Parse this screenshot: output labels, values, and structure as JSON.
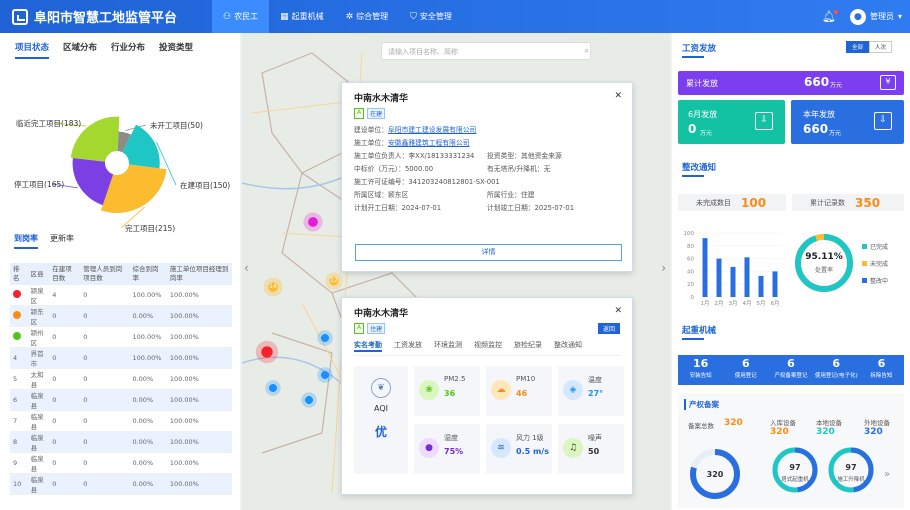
{
  "header": {
    "title": "阜阳市智慧工地监管平台",
    "nav": [
      {
        "icon": "⚇",
        "label": "农民工"
      },
      {
        "icon": "▦",
        "label": "起重机械"
      },
      {
        "icon": "✲",
        "label": "综合管理"
      },
      {
        "icon": "⛉",
        "label": "安全管理"
      }
    ],
    "user": "管理员"
  },
  "left": {
    "tabs": [
      "项目状态",
      "区域分布",
      "行业分布",
      "投资类型"
    ],
    "chart_data": {
      "type": "pie",
      "labels": [
        "未开工项目(50)",
        "在建项目(150)",
        "完工项目(215)",
        "停工项目(165)",
        "临近完工项目(183)"
      ],
      "values": [
        50,
        150,
        215,
        165,
        183
      ],
      "colors": [
        "#8c8c8c",
        "#1fc6c6",
        "#fbbc2f",
        "#7b3fe4",
        "#a4d82e"
      ]
    },
    "tabs2": [
      "到岗率",
      "更新率"
    ],
    "table": {
      "headers": [
        "排名",
        "区县",
        "在建项目数",
        "管理人员到岗项目数",
        "综合到岗率",
        "施工单位项目经理到岗率"
      ],
      "rows": [
        [
          "1",
          "颍泉区",
          "4",
          "0",
          "100.00%",
          "100.00%"
        ],
        [
          "2",
          "颍东区",
          "0",
          "0",
          "0.00%",
          "100.00%"
        ],
        [
          "3",
          "颍州区",
          "0",
          "0",
          "100.00%",
          "100.00%"
        ],
        [
          "4",
          "界首市",
          "0",
          "0",
          "100.00%",
          "100.00%"
        ],
        [
          "5",
          "太和县",
          "0",
          "0",
          "0.00%",
          "100.00%"
        ],
        [
          "6",
          "临泉县",
          "0",
          "0",
          "0.00%",
          "100.00%"
        ],
        [
          "7",
          "临泉县",
          "0",
          "0",
          "0.00%",
          "100.00%"
        ],
        [
          "8",
          "临泉县",
          "0",
          "0",
          "0.00%",
          "100.00%"
        ],
        [
          "9",
          "临泉县",
          "0",
          "0",
          "0.00%",
          "100.00%"
        ],
        [
          "10",
          "临泉县",
          "0",
          "0",
          "0.00%",
          "100.00%"
        ]
      ]
    }
  },
  "map": {
    "search_placeholder": "请输入项目名称、简称",
    "markers": [
      "14",
      "12"
    ],
    "card1": {
      "title": "中南水木清华",
      "tags": [
        "A",
        "在建"
      ],
      "rows": [
        [
          {
            "k": "建设单位：",
            "v": "阜阳市建工建设发展有限公司",
            "link": true
          }
        ],
        [
          {
            "k": "施工单位：",
            "v": "安徽鑫雅建筑工程有限公司",
            "link": true
          }
        ],
        [
          {
            "k": "施工单位负责人：",
            "v": "李XX/18133331234"
          },
          {
            "k": "投资类型：",
            "v": "其他资金来源"
          }
        ],
        [
          {
            "k": "中标价（万元）：",
            "v": "5000.00"
          },
          {
            "k": "有无塔吊/升降机：",
            "v": "无"
          }
        ],
        [
          {
            "k": "施工许可证编号：",
            "v": "341203240812801-SX-001"
          }
        ],
        [
          {
            "k": "所属区域：",
            "v": "颍东区"
          },
          {
            "k": "所属行业：",
            "v": "住建"
          }
        ],
        [
          {
            "k": "计划开工日期：",
            "v": "2024-07-01"
          },
          {
            "k": "计划竣工日期：",
            "v": "2025-07-01"
          }
        ]
      ],
      "detail_btn": "详情"
    },
    "card2": {
      "title": "中南水木清华",
      "tags": [
        "A",
        "住建"
      ],
      "back": "返回",
      "tabs": [
        "实名考勤",
        "工资发放",
        "环境监测",
        "视频监控",
        "旅检纪录",
        "整改通知"
      ],
      "aqi_label": "AQI",
      "aqi_value": "优",
      "items": [
        {
          "icon": "❀",
          "name": "PM2.5",
          "value": "36",
          "color": "#52c41a",
          "bg": "#d9f7be"
        },
        {
          "icon": "☁",
          "name": "PM10",
          "value": "46",
          "color": "#fa8c16",
          "bg": "#ffe7ba"
        },
        {
          "icon": "◈",
          "name": "温度",
          "value": "27°",
          "color": "#1890ff",
          "bg": "#d6e8ff"
        },
        {
          "icon": "●",
          "name": "湿度",
          "value": "75%",
          "color": "#722ed1",
          "bg": "#efdbff"
        },
        {
          "icon": "≋",
          "name": "风力 1级",
          "value": "0.5 m/s",
          "color": "#1f63d6",
          "bg": "#d6e8ff"
        },
        {
          "icon": "♫",
          "name": "噪声",
          "value": "50",
          "color": "#333",
          "bg": "#d9f7be"
        }
      ]
    }
  },
  "right": {
    "wage_title": "工资发放",
    "toggle": [
      "全部",
      "人次"
    ],
    "total_label": "累计发放",
    "total_value": "660",
    "unit": "万元",
    "month_label": "6月发放",
    "month_value": "0",
    "year_label": "本年发放",
    "year_value": "660",
    "notice_title": "整改通知",
    "pending_label": "未完成数目",
    "pending_value": "100",
    "total_notice_label": "累计记录数",
    "total_notice_value": "350",
    "chart_data": {
      "type": "bar",
      "categories": [
        "1月",
        "2月",
        "3月",
        "4月",
        "5月",
        "6月"
      ],
      "values": [
        92,
        60,
        47,
        62,
        33,
        40
      ],
      "ylim": [
        0,
        100
      ],
      "yticks": [
        0,
        20,
        40,
        60,
        80,
        100
      ]
    },
    "rate_value": "95.11%",
    "rate_label": "处置率",
    "legend": [
      {
        "name": "已完成",
        "color": "#1fc6c6"
      },
      {
        "name": "未完成",
        "color": "#fbbc2f"
      },
      {
        "name": "整改中",
        "color": "#2a6fe0"
      }
    ],
    "crane_title": "起重机械",
    "stats": [
      {
        "v": "16",
        "l": "安装告知"
      },
      {
        "v": "6",
        "l": "使用登记"
      },
      {
        "v": "6",
        "l": "产权备案登记"
      },
      {
        "v": "6",
        "l": "使用登记(电子化)"
      },
      {
        "v": "6",
        "l": "拆除告知"
      }
    ],
    "prop_title": "产权备案",
    "prop_total_label": "备案总数",
    "prop_total": "320",
    "prop_items": [
      {
        "l": "入库设备",
        "v": "320"
      },
      {
        "l": "本地设备",
        "v": "320"
      },
      {
        "l": "外地设备",
        "v": "320"
      }
    ],
    "ring_total": "320",
    "ring1_v": "97",
    "ring1_l": "塔式起重机",
    "ring2_v": "97",
    "ring2_l": "施工升降机"
  }
}
